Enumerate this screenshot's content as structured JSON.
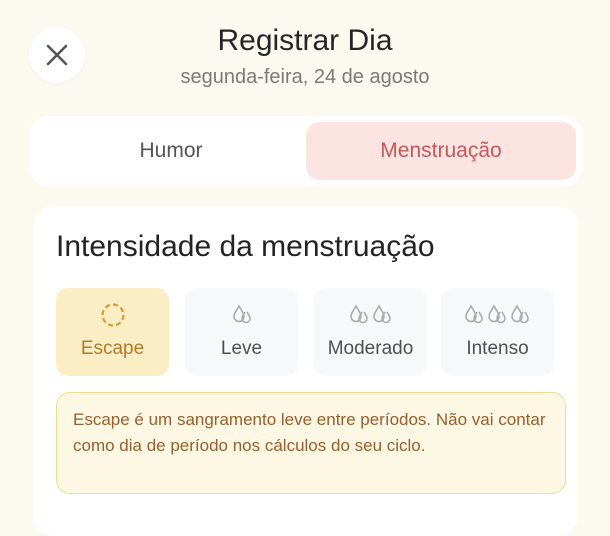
{
  "header": {
    "title": "Registrar Dia",
    "subtitle": "segunda-feira, 24 de agosto",
    "close_icon": "close-icon"
  },
  "tabs": [
    {
      "label": "Humor",
      "selected": false
    },
    {
      "label": "Menstruação",
      "selected": true
    }
  ],
  "flow": {
    "title": "Intensidade da menstruação",
    "options": [
      {
        "label": "Escape",
        "icon": "dashed-circle-icon",
        "selected": true
      },
      {
        "label": "Leve",
        "icon": "drop-icon",
        "drops": 1,
        "selected": false
      },
      {
        "label": "Moderado",
        "icon": "drop-icon",
        "drops": 2,
        "selected": false
      },
      {
        "label": "Intenso",
        "icon": "drop-icon",
        "drops": 3,
        "selected": false
      }
    ],
    "info": "Escape é um sangramento leve entre períodos. Não vai contar como dia de período nos cálculos do seu ciclo."
  },
  "colors": {
    "background": "#fcf9f1",
    "selected_tab_bg": "#fbe4e1",
    "selected_tab_text": "#c55858",
    "selected_option_bg": "#fbeec4",
    "selected_option_text": "#b07a28",
    "info_bg": "#fdf8e3",
    "info_border": "#f1dd8d",
    "info_text": "#9a5d2e"
  }
}
